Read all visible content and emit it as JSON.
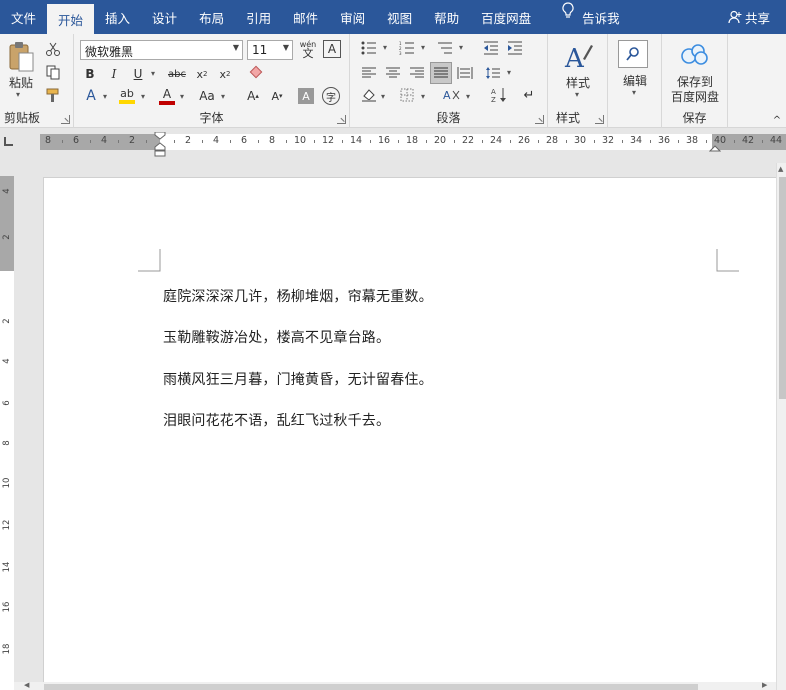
{
  "tabs": [
    "文件",
    "开始",
    "插入",
    "设计",
    "布局",
    "引用",
    "邮件",
    "审阅",
    "视图",
    "帮助",
    "百度网盘",
    "告诉我"
  ],
  "active_tab": "开始",
  "share_label": "共享",
  "clipboard": {
    "paste_label": "粘贴",
    "group_label": "剪贴板"
  },
  "font": {
    "name": "微软雅黑",
    "size": "11",
    "group_label": "字体",
    "wen_top": "wén",
    "wen_bottom": "文"
  },
  "paragraph": {
    "group_label": "段落"
  },
  "styles": {
    "button_label": "样式",
    "group_label": "样式"
  },
  "editing": {
    "button_label": "编辑"
  },
  "save": {
    "button_line1": "保存到",
    "button_line2": "百度网盘",
    "group_label": "保存"
  },
  "ruler_numbers": [
    "8",
    "6",
    "4",
    "2",
    "2",
    "4",
    "6",
    "8",
    "10",
    "12",
    "14",
    "16",
    "18",
    "20",
    "22",
    "24",
    "26",
    "28",
    "30",
    "32",
    "34",
    "36",
    "38",
    "40",
    "42",
    "44"
  ],
  "vruler_numbers": [
    "4",
    "2",
    "2",
    "4",
    "6",
    "8",
    "10",
    "12",
    "14",
    "16",
    "18"
  ],
  "document": {
    "paragraphs": [
      "庭院深深深几许，杨柳堆烟，帘幕无重数。",
      "玉勒雕鞍游冶处，楼高不见章台路。",
      "雨横风狂三月暮，门掩黄昏，无计留春住。",
      "泪眼问花花不语，乱红飞过秋千去。"
    ]
  },
  "colors": {
    "accent": "#2b579a",
    "highlight": "#ffd700",
    "font_color": "#c00000"
  }
}
